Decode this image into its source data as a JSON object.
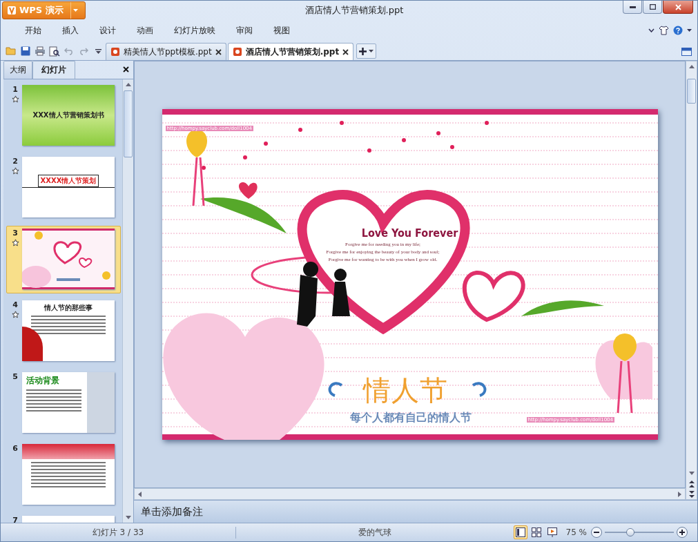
{
  "app_button": {
    "label": "WPS 演示"
  },
  "window": {
    "title": "酒店情人节营销策划.ppt"
  },
  "menu": [
    {
      "label": "开始"
    },
    {
      "label": "插入"
    },
    {
      "label": "设计"
    },
    {
      "label": "动画"
    },
    {
      "label": "幻灯片放映"
    },
    {
      "label": "审阅"
    },
    {
      "label": "视图"
    }
  ],
  "doc_tabs": [
    {
      "label": "精美情人节ppt模板.ppt",
      "selected": false
    },
    {
      "label": "酒店情人节营销策划.ppt",
      "selected": true
    }
  ],
  "panel_tabs": [
    {
      "label": "大纲",
      "selected": false
    },
    {
      "label": "幻灯片",
      "selected": true
    }
  ],
  "thumbnails": [
    {
      "number": "1",
      "animated": true,
      "selected": false,
      "kind": "green",
      "title": "XXX情人节营销策划书"
    },
    {
      "number": "2",
      "animated": true,
      "selected": false,
      "kind": "boxed",
      "title": "XXXX情人节策划"
    },
    {
      "number": "3",
      "animated": true,
      "selected": true,
      "kind": "love"
    },
    {
      "number": "4",
      "animated": true,
      "selected": false,
      "kind": "roses",
      "title": "情人节的那些事"
    },
    {
      "number": "5",
      "animated": false,
      "selected": false,
      "kind": "couple",
      "title": "活动背景"
    },
    {
      "number": "6",
      "animated": false,
      "selected": false,
      "kind": "banner"
    },
    {
      "number": "7",
      "animated": false,
      "selected": false,
      "kind": "cut"
    }
  ],
  "slide": {
    "heading": "Love You Forever",
    "poem": [
      "Forgive me for needing you in my life;",
      "Forgive me for enjoying the beauty of your body and soul;",
      "Forgive me for wanting to be with you when I grow old."
    ],
    "title": "情人节",
    "subtitle": "每个人都有自己的情人节",
    "links": [
      "http://hompy.sayclub.com/doll1004",
      "http://hompy.sayclub.com/doll1004"
    ]
  },
  "notes": {
    "placeholder": "单击添加备注"
  },
  "status_bar": {
    "slide_counter": "幻灯片 3 / 33",
    "theme": "爱的气球",
    "view_buttons": [
      {
        "kind": "normal",
        "selected": true
      },
      {
        "kind": "sorter",
        "selected": false
      },
      {
        "kind": "show",
        "selected": false
      }
    ],
    "zoom": "75 %",
    "zoom_slider": {
      "level": 0.36
    }
  }
}
